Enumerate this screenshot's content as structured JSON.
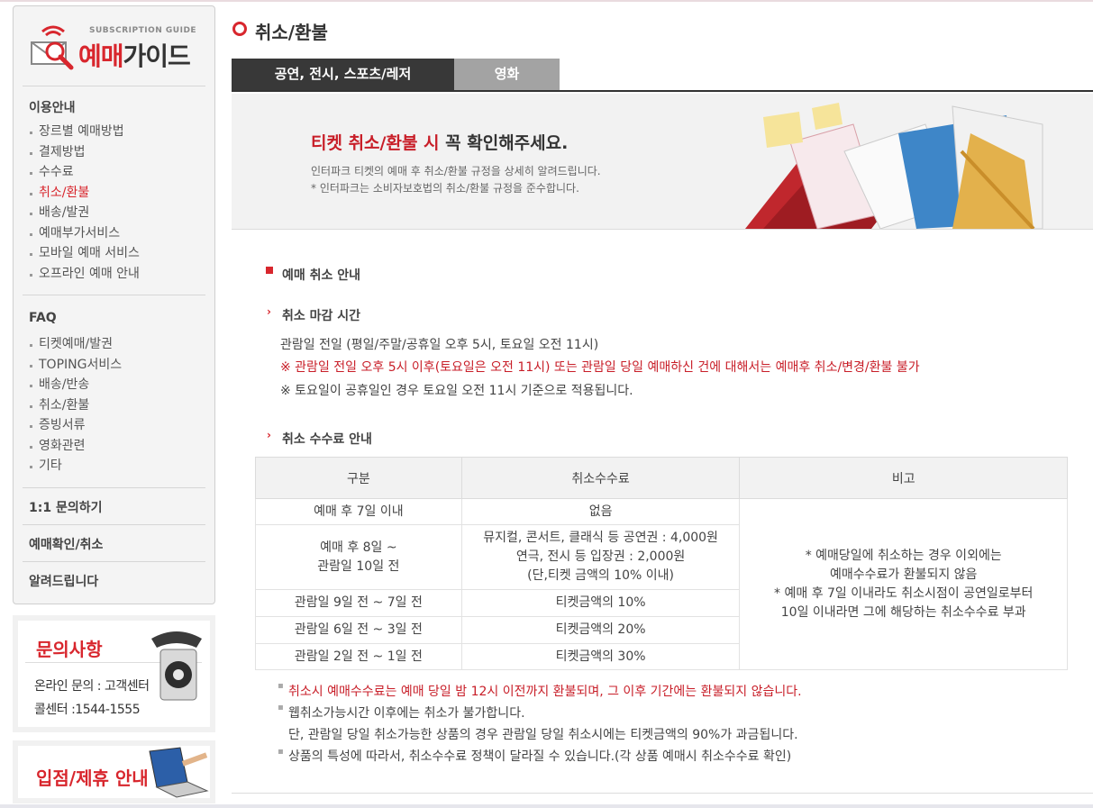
{
  "logo": {
    "sub": "SUBSCRIPTION GUIDE",
    "main_red": "예매",
    "main_dark": "가이드"
  },
  "sidebar": {
    "usage_title": "이용안내",
    "usage_items": [
      "장르별 예매방법",
      "결제방법",
      "수수료",
      "취소/환불",
      "배송/발권",
      "예매부가서비스",
      "모바일 예매 서비스",
      "오프라인 예매 안내"
    ],
    "faq_title": "FAQ",
    "faq_items": [
      "티켓예매/발권",
      "TOPING서비스",
      "배송/반송",
      "취소/환불",
      "증빙서류",
      "영화관련",
      "기타"
    ],
    "inquiry": "1:1 문의하기",
    "confirm": "예매확인/취소",
    "notice": "알려드립니다"
  },
  "banner_contact": {
    "title": "문의사항",
    "line1": "온라인 문의 : 고객센터",
    "line2": "콜센터 :1544-1555"
  },
  "banner_partner": {
    "title": "입점/제휴 안내"
  },
  "page": {
    "title": "취소/환불"
  },
  "tabs": [
    "공연, 전시, 스포츠/레저",
    "영화"
  ],
  "hero": {
    "head_red": "티켓 취소/환불 시",
    "head_dark": " 꼭 확인해주세요.",
    "sub1": "인터파크 티켓의 예매 후 취소/환불 규정을 상세히 알려드립니다.",
    "sub2": "* 인터파크는 소비자보호법의 취소/환불 규정을 준수합니다."
  },
  "section": {
    "title": "예매 취소 안내",
    "deadline_title": "취소 마감 시간",
    "deadline_lines": [
      "관람일 전일 (평일/주말/공휴일 오후 5시, 토요일 오전 11시)",
      "※ 관람일 전일 오후 5시 이후(토요일은 오전 11시) 또는 관람일 당일 예매하신 건에 대해서는 예매후 취소/변경/환불 불가",
      "※ 토요일이 공휴일인 경우 토요일 오전 11시 기준으로 적용됩니다."
    ],
    "fee_title": "취소 수수료 안내"
  },
  "fee_table": {
    "headers": [
      "구분",
      "취소수수료",
      "비고"
    ],
    "rows": [
      {
        "period": "예매 후 7일 이내",
        "fee": "없음"
      },
      {
        "period1": "예매 후 8일 ~",
        "period2": "관람일 10일 전",
        "fee1": "뮤지컬, 콘서트, 클래식 등 공연권 : 4,000원",
        "fee2": "연극, 전시 등 입장권 : 2,000원",
        "fee3": "(단,티켓 금액의 10% 이내)"
      },
      {
        "period": "관람일 9일 전 ~ 7일 전",
        "fee": "티켓금액의 10%"
      },
      {
        "period": "관람일 6일 전 ~ 3일 전",
        "fee": "티켓금액의 20%"
      },
      {
        "period": "관람일 2일 전 ~ 1일 전",
        "fee": "티켓금액의 30%"
      }
    ],
    "remark": [
      "* 예매당일에 취소하는 경우 이외에는",
      "예매수수료가 환불되지 않음",
      "* 예매 후 7일 이내라도 취소시점이 공연일로부터",
      "10일 이내라면 그에 해당하는 취소수수료 부과"
    ]
  },
  "notes": [
    "취소시 예매수수료는 예매 당일 밤 12시 이전까지 환불되며, 그 이후 기간에는 환불되지 않습니다.",
    "웹취소가능시간 이후에는 취소가 불가합니다.",
    "단, 관람일 당일 취소가능한 상품의 경우 관람일 당일 취소시에는 티켓금액의 90%가 과금됩니다.",
    "상품의 특성에 따라서, 취소수수료 정책이 달라질 수 있습니다.(각 상품 예매시 취소수수료 확인)"
  ]
}
